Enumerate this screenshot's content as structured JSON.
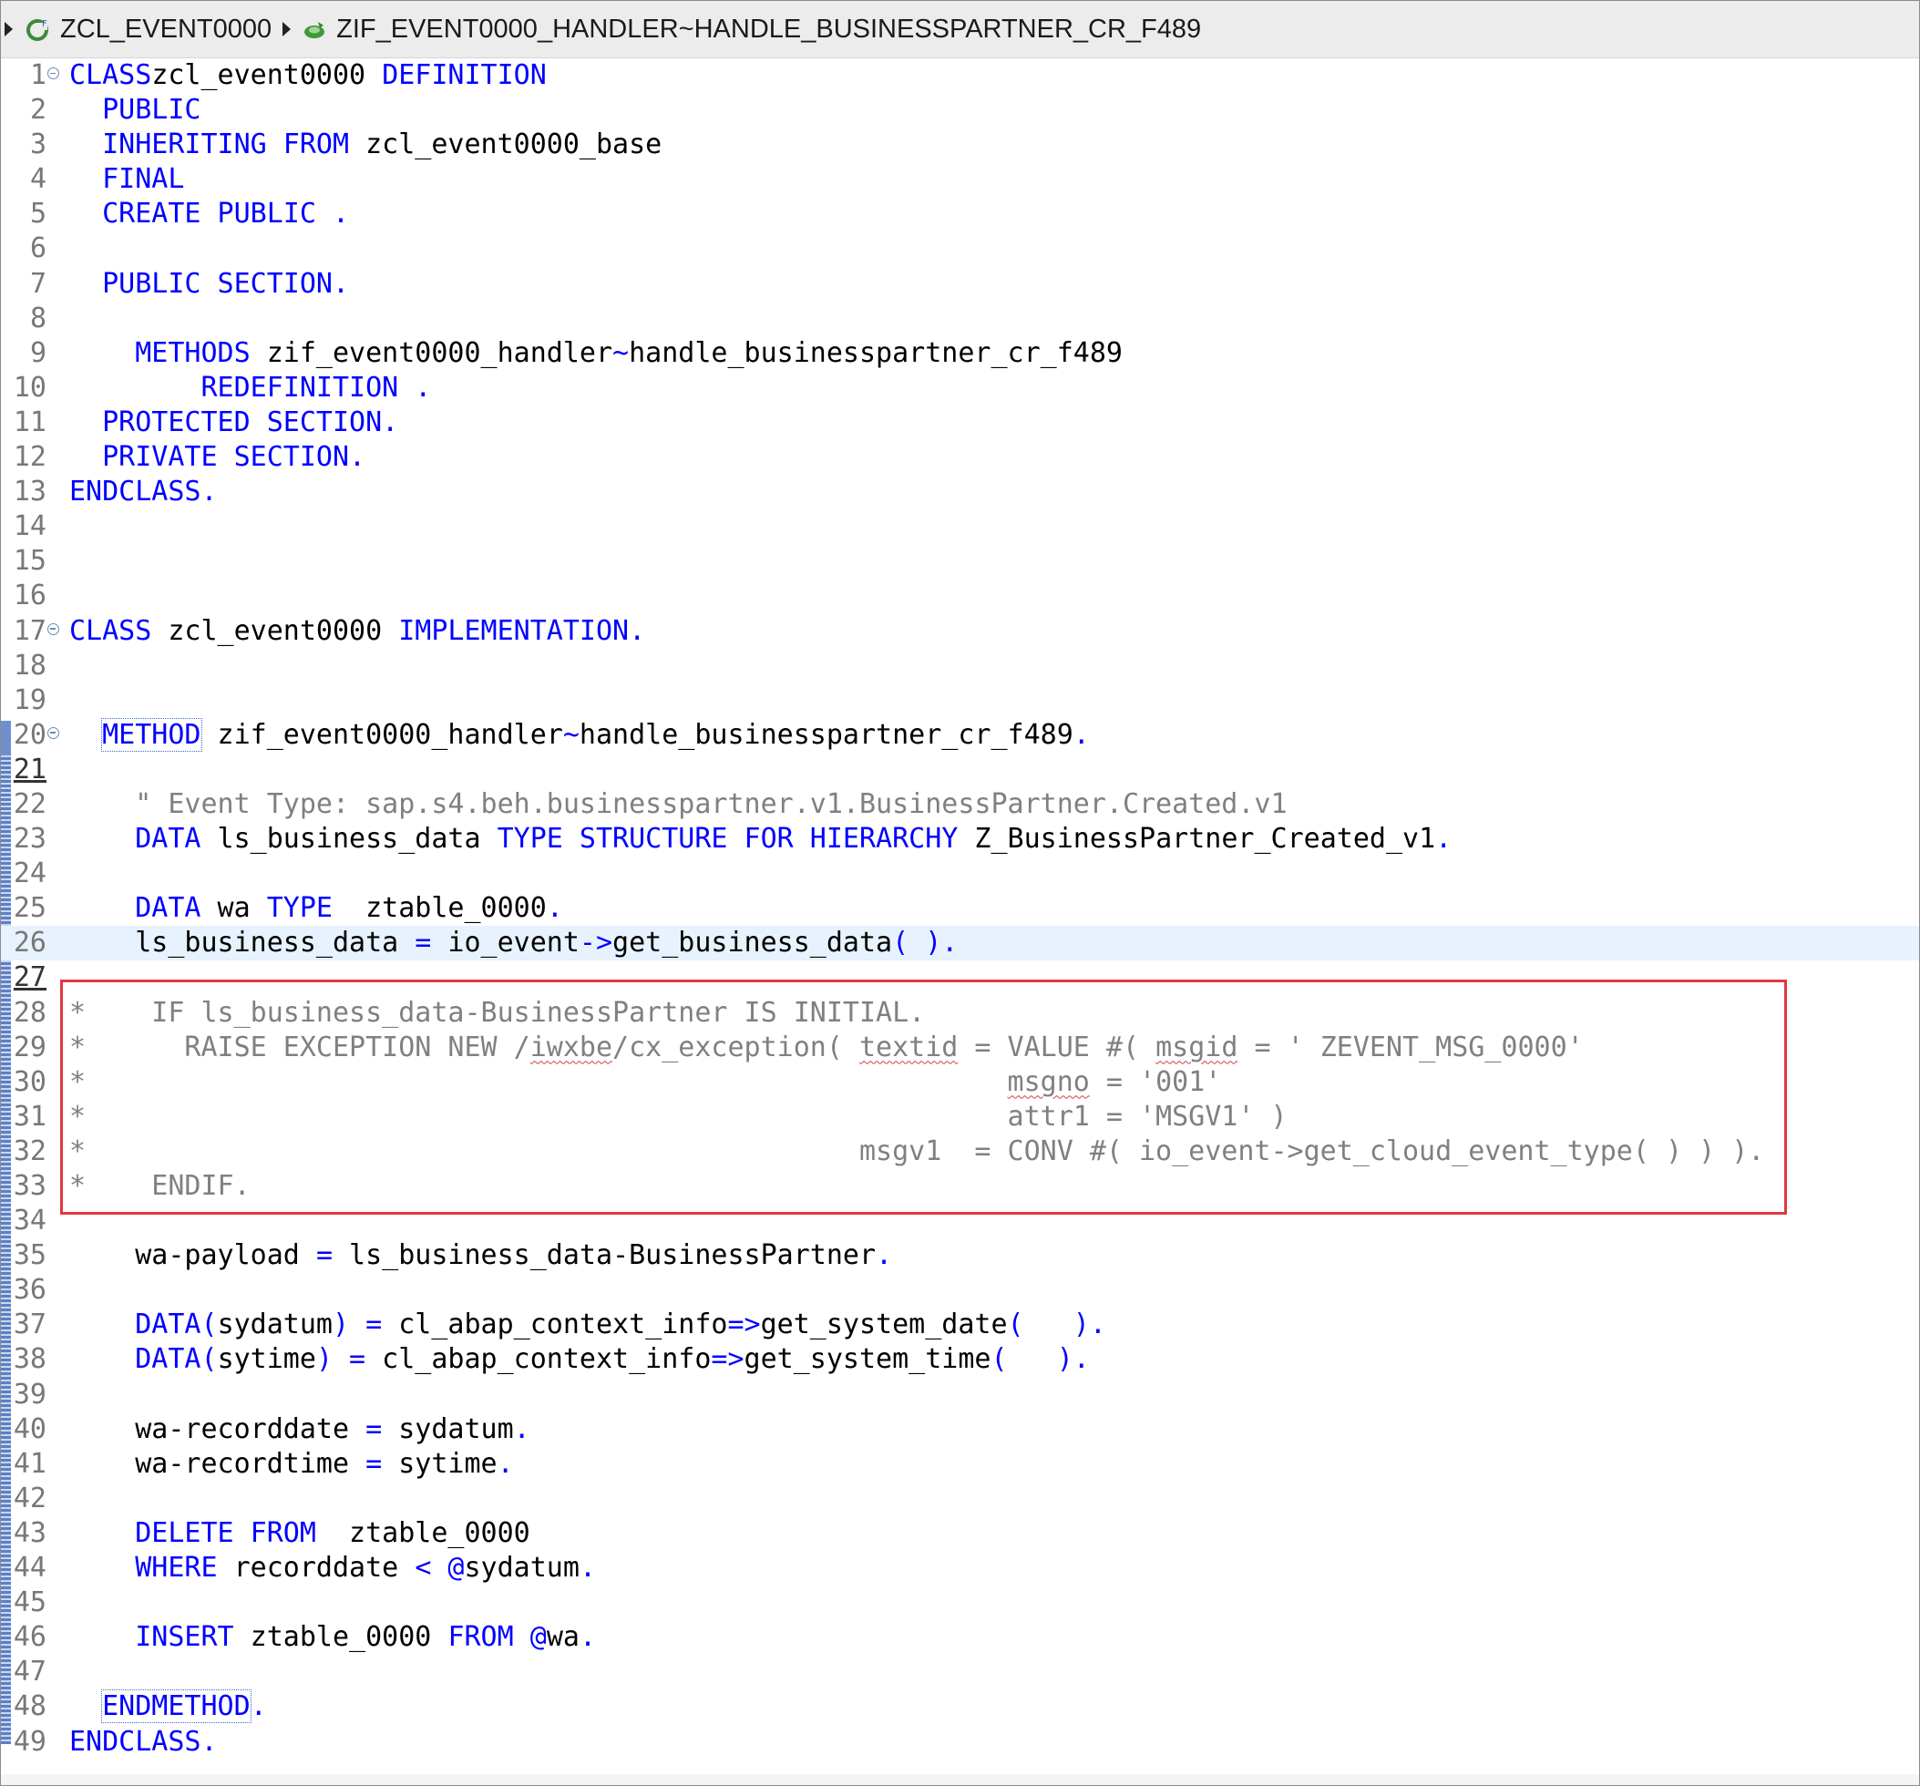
{
  "breadcrumb": {
    "class_name": "ZCL_EVENT0000",
    "method_name": "ZIF_EVENT0000_HANDLER~HANDLE_BUSINESSPARTNER_CR_F489",
    "class_icon": "abap-class-icon",
    "method_icon": "abap-method-icon"
  },
  "lines": [
    {
      "n": "1",
      "fold": true,
      "segs": [
        [
          "k",
          "CLASS"
        ],
        [
          "",
          "zcl_event0000 "
        ],
        [
          "k",
          "DEFINITION"
        ]
      ],
      "prefix": ""
    },
    {
      "n": "2",
      "segs": [
        [
          "k",
          "  PUBLIC"
        ]
      ]
    },
    {
      "n": "3",
      "segs": [
        [
          "k",
          "  INHERITING FROM"
        ],
        [
          "",
          " zcl_event0000_base"
        ]
      ]
    },
    {
      "n": "4",
      "segs": [
        [
          "k",
          "  FINAL"
        ]
      ]
    },
    {
      "n": "5",
      "segs": [
        [
          "k",
          "  CREATE PUBLIC ."
        ]
      ]
    },
    {
      "n": "6",
      "segs": []
    },
    {
      "n": "7",
      "segs": [
        [
          "k",
          "  PUBLIC SECTION."
        ]
      ]
    },
    {
      "n": "8",
      "segs": []
    },
    {
      "n": "9",
      "segs": [
        [
          "k",
          "    METHODS"
        ],
        [
          "",
          " zif_event0000_handler"
        ],
        [
          "k",
          "~"
        ],
        [
          "",
          "handle_businesspartner_cr_f489"
        ]
      ]
    },
    {
      "n": "10",
      "segs": [
        [
          "k",
          "        REDEFINITION ."
        ]
      ]
    },
    {
      "n": "11",
      "segs": [
        [
          "k",
          "  PROTECTED SECTION."
        ]
      ]
    },
    {
      "n": "12",
      "segs": [
        [
          "k",
          "  PRIVATE SECTION."
        ]
      ]
    },
    {
      "n": "13",
      "segs": [
        [
          "k",
          "ENDCLASS."
        ]
      ]
    },
    {
      "n": "14",
      "segs": []
    },
    {
      "n": "15",
      "segs": []
    },
    {
      "n": "16",
      "segs": []
    },
    {
      "n": "17",
      "fold": true,
      "segs": [
        [
          "k",
          "CLASS"
        ],
        [
          "",
          " zcl_event0000 "
        ],
        [
          "k",
          "IMPLEMENTATION."
        ]
      ]
    },
    {
      "n": "18",
      "segs": []
    },
    {
      "n": "19",
      "segs": []
    },
    {
      "n": "20",
      "fold": true,
      "segs": [
        [
          "",
          "  "
        ],
        [
          "kb",
          "METHOD"
        ],
        [
          "",
          " zif_event0000_handler"
        ],
        [
          "k",
          "~"
        ],
        [
          "",
          "handle_businesspartner_cr_f489"
        ],
        [
          "k",
          "."
        ]
      ]
    },
    {
      "n": "21",
      "u": true,
      "segs": []
    },
    {
      "n": "22",
      "segs": [
        [
          "c",
          "    \" Event Type: sap.s4.beh.businesspartner.v1.BusinessPartner.Created.v1"
        ]
      ]
    },
    {
      "n": "23",
      "segs": [
        [
          "k",
          "    DATA"
        ],
        [
          "",
          " ls_business_data "
        ],
        [
          "k",
          "TYPE STRUCTURE FOR HIERARCHY"
        ],
        [
          "",
          " Z_BusinessPartner_Created_v1"
        ],
        [
          "k",
          "."
        ]
      ]
    },
    {
      "n": "24",
      "segs": []
    },
    {
      "n": "25",
      "segs": [
        [
          "k",
          "    DATA"
        ],
        [
          "",
          " wa "
        ],
        [
          "k",
          "TYPE"
        ],
        [
          "",
          "  ztable_0000"
        ],
        [
          "k",
          "."
        ]
      ]
    },
    {
      "n": "26",
      "current": true,
      "segs": [
        [
          "",
          "    ls_business_data "
        ],
        [
          "k",
          "="
        ],
        [
          "",
          " io_event"
        ],
        [
          "k",
          "->"
        ],
        [
          "",
          "get_business_data"
        ],
        [
          "k",
          "( )."
        ]
      ]
    },
    {
      "n": "27",
      "u": true,
      "segs": []
    },
    {
      "n": "28",
      "segs": [
        [
          "c",
          "*    IF ls_business_data-BusinessPartner IS INITIAL."
        ]
      ]
    },
    {
      "n": "29",
      "segs": [
        [
          "c",
          "*      RAISE EXCEPTION NEW /"
        ],
        [
          "cs",
          "iwxbe"
        ],
        [
          "c",
          "/cx_exception( "
        ],
        [
          "cs",
          "textid"
        ],
        [
          "c",
          " = VALUE #( "
        ],
        [
          "cs",
          "msgid"
        ],
        [
          "c",
          " = ' ZEVENT_MSG_0000'"
        ]
      ]
    },
    {
      "n": "30",
      "segs": [
        [
          "c",
          "*                                                        "
        ],
        [
          "cs",
          "msgno"
        ],
        [
          "c",
          " = '001'"
        ]
      ]
    },
    {
      "n": "31",
      "segs": [
        [
          "c",
          "*                                                        attr1 = 'MSGV1' )"
        ]
      ]
    },
    {
      "n": "32",
      "segs": [
        [
          "c",
          "*                                               msgv1  = CONV #( io_event->get_cloud_event_type( ) ) )."
        ]
      ]
    },
    {
      "n": "33",
      "segs": [
        [
          "c",
          "*    ENDIF."
        ]
      ]
    },
    {
      "n": "34",
      "segs": []
    },
    {
      "n": "35",
      "segs": [
        [
          "",
          "    wa-payload "
        ],
        [
          "k",
          "="
        ],
        [
          "",
          " ls_business_data-BusinessPartner"
        ],
        [
          "k",
          "."
        ]
      ]
    },
    {
      "n": "36",
      "segs": []
    },
    {
      "n": "37",
      "segs": [
        [
          "k",
          "    DATA("
        ],
        [
          "",
          "sydatum"
        ],
        [
          "k",
          ") ="
        ],
        [
          "",
          " cl_abap_context_info"
        ],
        [
          "k",
          "=>"
        ],
        [
          "",
          "get_system_date"
        ],
        [
          "k",
          "(   )."
        ]
      ]
    },
    {
      "n": "38",
      "segs": [
        [
          "k",
          "    DATA("
        ],
        [
          "",
          "sytime"
        ],
        [
          "k",
          ") ="
        ],
        [
          "",
          " cl_abap_context_info"
        ],
        [
          "k",
          "=>"
        ],
        [
          "",
          "get_system_time"
        ],
        [
          "k",
          "(   )."
        ]
      ]
    },
    {
      "n": "39",
      "segs": []
    },
    {
      "n": "40",
      "segs": [
        [
          "",
          "    wa-recorddate "
        ],
        [
          "k",
          "="
        ],
        [
          "",
          " sydatum"
        ],
        [
          "k",
          "."
        ]
      ]
    },
    {
      "n": "41",
      "segs": [
        [
          "",
          "    wa-recordtime "
        ],
        [
          "k",
          "="
        ],
        [
          "",
          " sytime"
        ],
        [
          "k",
          "."
        ]
      ]
    },
    {
      "n": "42",
      "segs": []
    },
    {
      "n": "43",
      "segs": [
        [
          "k",
          "    DELETE FROM"
        ],
        [
          "",
          "  ztable_0000"
        ]
      ]
    },
    {
      "n": "44",
      "segs": [
        [
          "k",
          "    WHERE"
        ],
        [
          "",
          " recorddate "
        ],
        [
          "k",
          "< @"
        ],
        [
          "",
          "sydatum"
        ],
        [
          "k",
          "."
        ]
      ]
    },
    {
      "n": "45",
      "segs": []
    },
    {
      "n": "46",
      "segs": [
        [
          "k",
          "    INSERT"
        ],
        [
          "",
          " ztable_0000 "
        ],
        [
          "k",
          "FROM @"
        ],
        [
          "",
          "wa"
        ],
        [
          "k",
          "."
        ]
      ]
    },
    {
      "n": "47",
      "segs": []
    },
    {
      "n": "48",
      "segs": [
        [
          "",
          "  "
        ],
        [
          "kb",
          "ENDMETHOD"
        ],
        [
          "k",
          "."
        ]
      ]
    },
    {
      "n": "49",
      "segs": [
        [
          "k",
          "ENDCLASS."
        ]
      ]
    }
  ],
  "colors": {
    "keyword": "#0000ff",
    "comment": "#808080",
    "highlight_box": "#e0373f",
    "current_line": "#e8f2fe"
  }
}
